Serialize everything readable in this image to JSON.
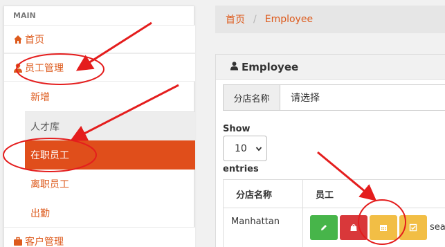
{
  "sidebar": {
    "section_label": "MAIN",
    "home": {
      "label": "首页",
      "icon": "home-icon"
    },
    "employee_mgmt": {
      "label": "员工管理",
      "icon": "user-icon"
    },
    "sub_items": [
      {
        "label": "新增"
      },
      {
        "label": "人才库"
      },
      {
        "label": "在职员工"
      },
      {
        "label": "离职员工"
      },
      {
        "label": "出勤"
      }
    ],
    "customer_mgmt": {
      "label": "客户管理",
      "icon": "briefcase-icon"
    }
  },
  "breadcrumb": {
    "home": "首页",
    "separator": "/",
    "current": "Employee"
  },
  "panel": {
    "title": "Employee",
    "title_icon": "user-icon",
    "branch_filter": {
      "label": "分店名称",
      "value": "请选择"
    },
    "show_label": "Show",
    "page_length": "10",
    "entries_label": "entries",
    "table": {
      "headers": [
        "分店名称",
        "员工"
      ],
      "rows": [
        {
          "branch": "Manhattan",
          "action_text": "sea"
        }
      ]
    }
  },
  "colors": {
    "accent": "#dd5a1c",
    "active_bg": "#e04e1b",
    "annotation_red": "#e41d1d",
    "btn_green": "#47b54a",
    "btn_red": "#d9383a",
    "btn_yellow": "#f2be45"
  }
}
